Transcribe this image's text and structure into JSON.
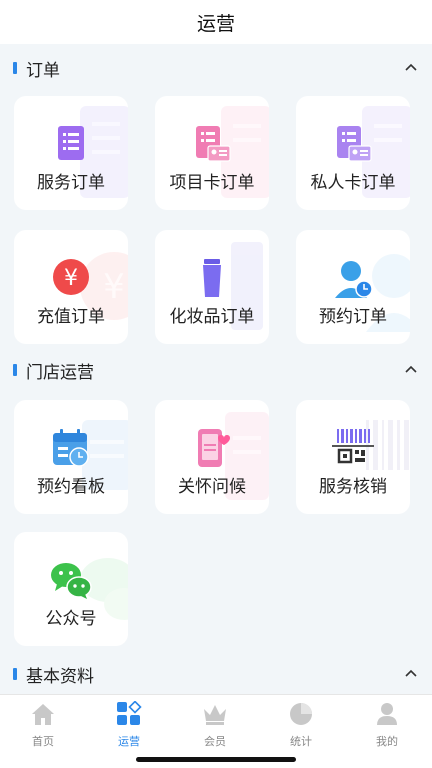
{
  "header": {
    "title": "运营"
  },
  "sections": {
    "orders": {
      "title": "订单",
      "items": [
        "服务订单",
        "项目卡订单",
        "私人卡订单",
        "充值订单",
        "化妆品订单",
        "预约订单"
      ]
    },
    "store": {
      "title": "门店运营",
      "items": [
        "预约看板",
        "关怀问候",
        "服务核销",
        "公众号"
      ]
    },
    "basic": {
      "title": "基本资料"
    }
  },
  "icons": {
    "orders": [
      "service-order-icon",
      "project-card-icon",
      "private-card-icon",
      "yen-coin-icon",
      "cosmetic-tube-icon",
      "appointment-person-icon"
    ],
    "store": [
      "calendar-board-icon",
      "phone-heart-icon",
      "barcode-icon",
      "wechat-icon"
    ]
  },
  "tabbar": {
    "items": [
      {
        "label": "首页",
        "icon": "home-icon"
      },
      {
        "label": "运营",
        "icon": "grid-diamond-icon"
      },
      {
        "label": "会员",
        "icon": "crown-icon"
      },
      {
        "label": "统计",
        "icon": "pie-icon"
      },
      {
        "label": "我的",
        "icon": "person-icon"
      }
    ],
    "active_index": 1
  },
  "colors": {
    "accent": "#2b87e8",
    "background": "#f2f6f9",
    "inactive": "#c8c8c8"
  }
}
